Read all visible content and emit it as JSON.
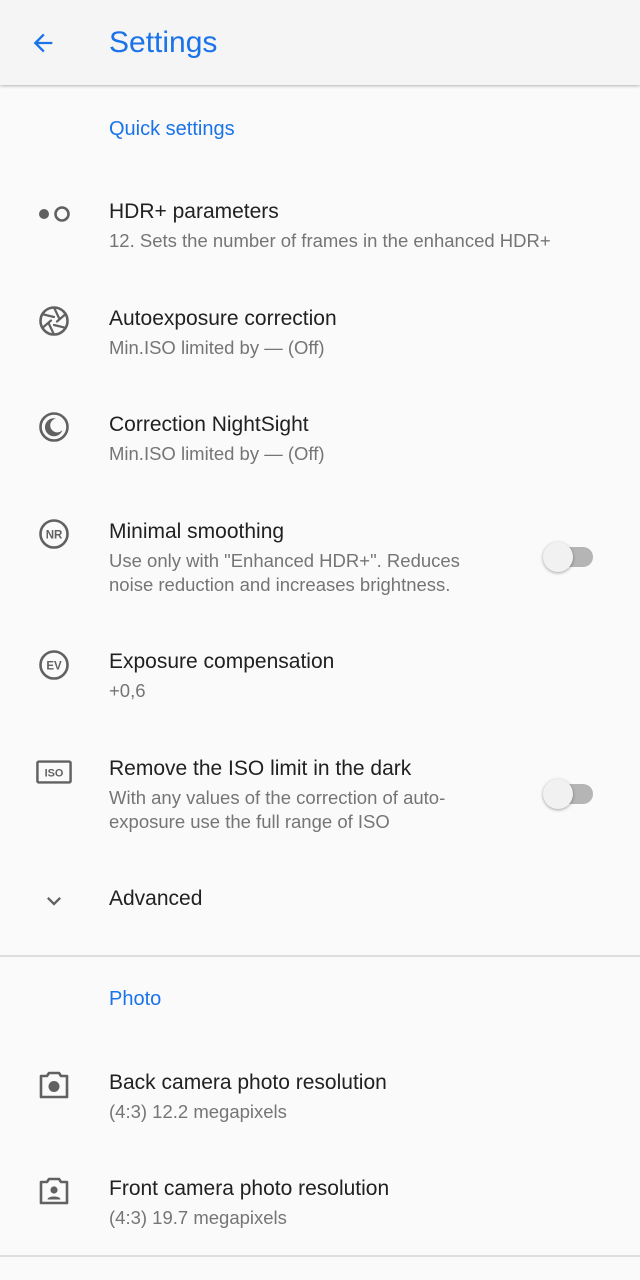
{
  "appbar": {
    "title": "Settings",
    "back_icon": "arrow-back-icon"
  },
  "colors": {
    "accent": "#1a73e8",
    "title_text": "#212121",
    "summary_text": "#757575",
    "icon": "#616161"
  },
  "quick_settings": {
    "header": "Quick settings",
    "items": [
      {
        "icon": "hdr-dots-icon",
        "title": "HDR+ parameters",
        "summary": "12. Sets the number of frames in the enhanced HDR+"
      },
      {
        "icon": "aperture-icon",
        "title": "Autoexposure correction",
        "summary": "Min.ISO limited by — (Off)"
      },
      {
        "icon": "moon-icon",
        "title": "Correction NightSight",
        "summary": "Min.ISO limited by — (Off)"
      },
      {
        "icon": "nr-icon",
        "title": "Minimal smoothing",
        "summary": "Use only with \"Enhanced HDR+\". Reduces noise reduction and increases brightness.",
        "toggle": false
      },
      {
        "icon": "ev-icon",
        "title": "Exposure compensation",
        "summary": "+0,6"
      },
      {
        "icon": "iso-icon",
        "title": "Remove the ISO limit in the dark",
        "summary": "With any values of the correction of auto-exposure use the full range of ISO",
        "toggle": false
      }
    ],
    "advanced": {
      "icon": "chevron-down-icon",
      "label": "Advanced"
    }
  },
  "photo": {
    "header": "Photo",
    "items": [
      {
        "icon": "camera-icon",
        "title": "Back camera photo resolution",
        "summary": "(4:3) 12.2 megapixels"
      },
      {
        "icon": "front-camera-icon",
        "title": "Front camera photo resolution",
        "summary": "(4:3) 19.7 megapixels"
      }
    ]
  },
  "icon_text": {
    "nr": "NR",
    "ev": "EV",
    "iso": "ISO"
  }
}
